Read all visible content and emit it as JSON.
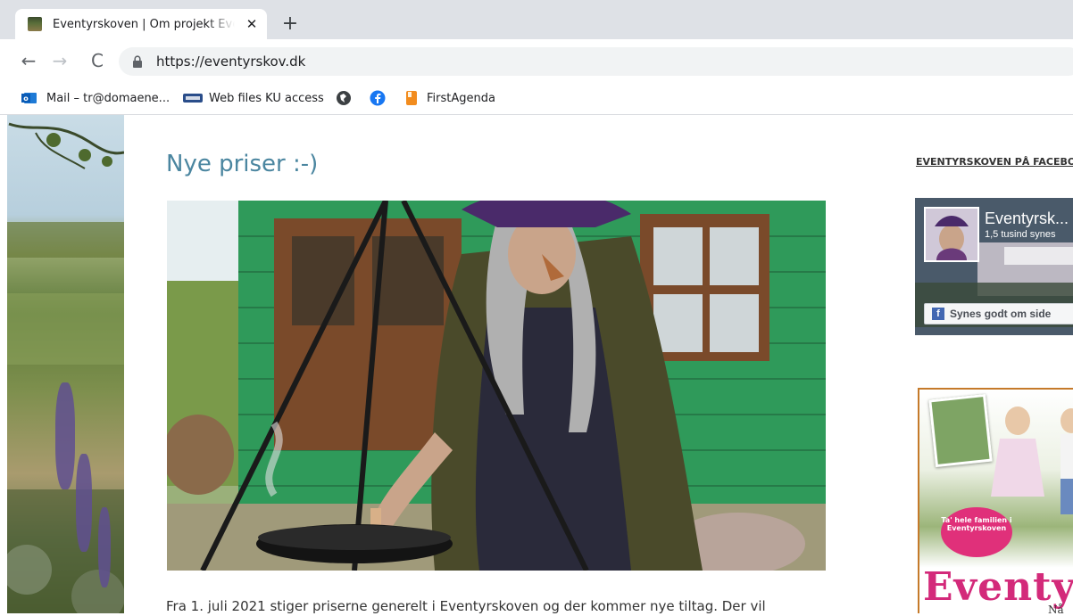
{
  "browser": {
    "tab": {
      "title": "Eventyrskoven | Om projekt Eventyrskoven",
      "close_glyph": "✕"
    },
    "new_tab_glyph": "+",
    "nav": {
      "back": "←",
      "forward": "→",
      "reload": "C"
    },
    "url": "https://eventyrskov.dk",
    "bookmarks": [
      {
        "label": "Mail – tr@domaene...",
        "icon": "outlook-icon"
      },
      {
        "label": "Web files KU access",
        "icon": "webfiles-icon"
      },
      {
        "label": "",
        "icon": "globe-icon"
      },
      {
        "label": "",
        "icon": "facebook-icon"
      },
      {
        "label": "FirstAgenda",
        "icon": "firstagenda-icon"
      }
    ]
  },
  "post": {
    "title": "Nye priser :-)",
    "body_start": "Fra 1. juli 2021 stiger priserne generelt i Eventyrskoven og der kommer nye tiltag. Der vil"
  },
  "sidebar": {
    "widget_title": "EVENTYRSKOVEN PÅ FACEBOOK",
    "facebook": {
      "page_name": "Eventyrsk...",
      "likes": "1,5 tusind synes",
      "like_button": "Synes godt om side",
      "f_glyph": "f"
    },
    "ad": {
      "badge": "Ta' hele familien i Eventyrskoven",
      "logo": "Eventyrs",
      "sub": "Nå"
    }
  },
  "colors": {
    "title_blue": "#4b86a0",
    "chrome_gray": "#dee1e6",
    "facebook_blue": "#4267b2",
    "ad_pink": "#d32a7a"
  }
}
